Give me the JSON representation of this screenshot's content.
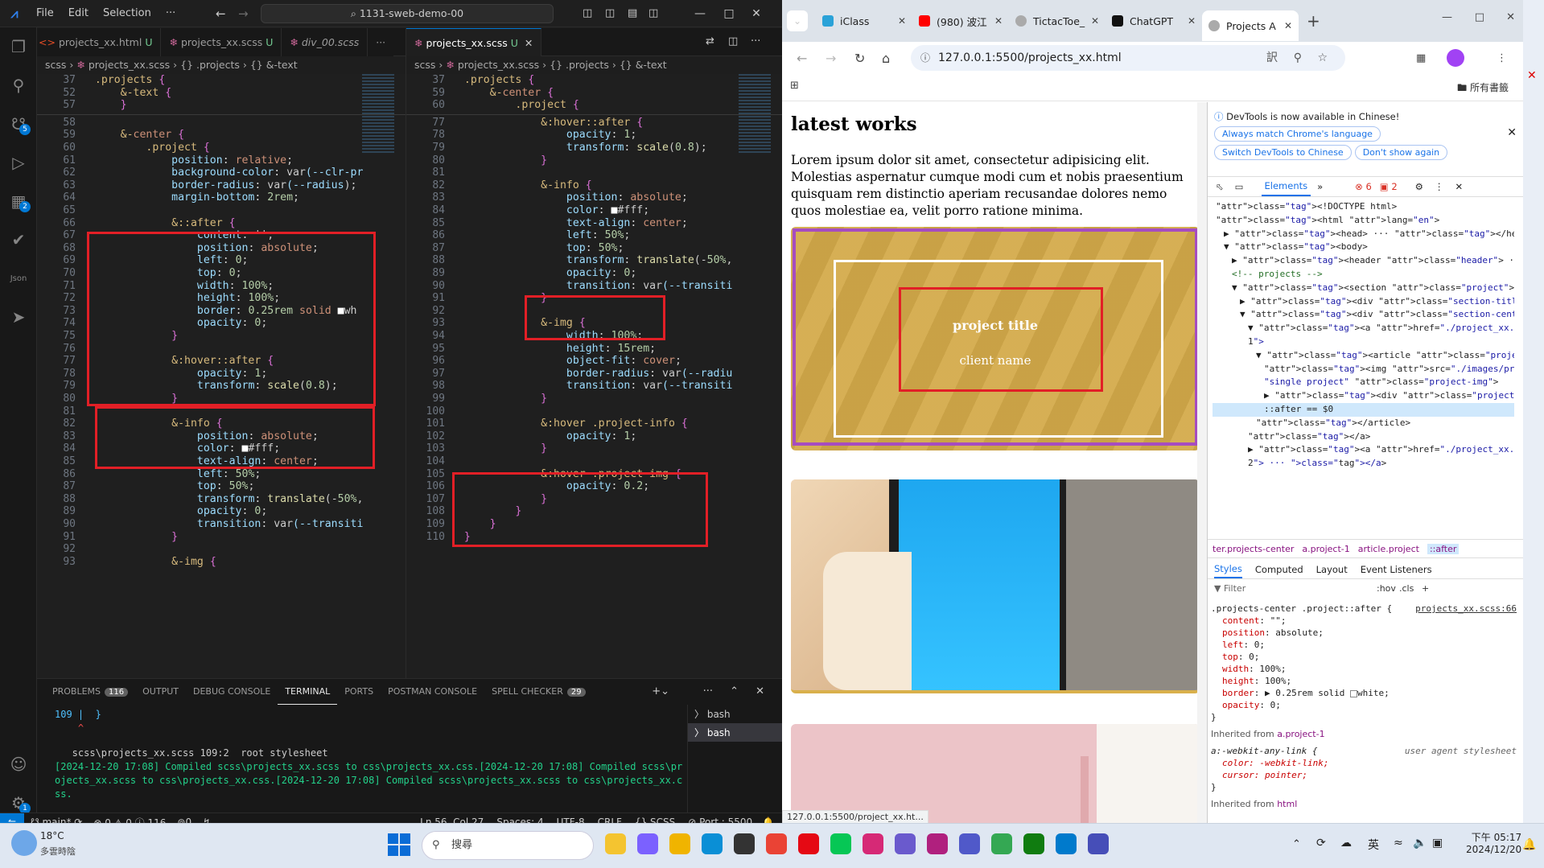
{
  "vscode": {
    "menu": [
      "File",
      "Edit",
      "Selection",
      "···"
    ],
    "command_center": "⌕ 1131-sweb-demo-00",
    "activity_badges": {
      "source_control": "5",
      "extensions": "2",
      "accounts_settings": "1"
    },
    "left_tabs": [
      {
        "label": "projects_xx.html",
        "status": "U"
      },
      {
        "label": "projects_xx.scss",
        "status": "U"
      },
      {
        "label": "div_00.scss",
        "status": ""
      }
    ],
    "right_tabs": [
      {
        "label": "projects_xx.scss",
        "status": "U"
      }
    ],
    "breadcrumb_left": [
      "scss",
      "projects_xx.scss",
      "{} .projects",
      "{} &-text"
    ],
    "breadcrumb_right": [
      "scss",
      "projects_xx.scss",
      "{} .projects",
      "{} &-text"
    ],
    "left_editor": {
      "sticky": [
        {
          "n": "37",
          "t": "  .projects {"
        },
        {
          "n": "52",
          "t": "      &-text {"
        },
        {
          "n": "57",
          "t": "      }"
        }
      ],
      "lines": [
        {
          "n": "58",
          "t": ""
        },
        {
          "n": "59",
          "t": "      &-center {"
        },
        {
          "n": "60",
          "t": "          .project {"
        },
        {
          "n": "61",
          "t": "              position: relative;"
        },
        {
          "n": "62",
          "t": "              background-color: var(--clr-pr"
        },
        {
          "n": "63",
          "t": "              border-radius: var(--radius);"
        },
        {
          "n": "64",
          "t": "              margin-bottom: 2rem;"
        },
        {
          "n": "65",
          "t": ""
        },
        {
          "n": "66",
          "t": "              &::after {"
        },
        {
          "n": "67",
          "t": "                  content: '';"
        },
        {
          "n": "68",
          "t": "                  position: absolute;"
        },
        {
          "n": "69",
          "t": "                  left: 0;"
        },
        {
          "n": "70",
          "t": "                  top: 0;"
        },
        {
          "n": "71",
          "t": "                  width: 100%;"
        },
        {
          "n": "72",
          "t": "                  height: 100%;"
        },
        {
          "n": "73",
          "t": "                  border: 0.25rem solid □wh"
        },
        {
          "n": "74",
          "t": "                  opacity: 0;"
        },
        {
          "n": "75",
          "t": "              }"
        },
        {
          "n": "76",
          "t": ""
        },
        {
          "n": "77",
          "t": "              &:hover::after {"
        },
        {
          "n": "78",
          "t": "                  opacity: 1;"
        },
        {
          "n": "79",
          "t": "                  transform: scale(0.8);"
        },
        {
          "n": "80",
          "t": "              }"
        },
        {
          "n": "81",
          "t": ""
        },
        {
          "n": "82",
          "t": "              &-info {"
        },
        {
          "n": "83",
          "t": "                  position: absolute;"
        },
        {
          "n": "84",
          "t": "                  color: □#fff;"
        },
        {
          "n": "85",
          "t": "                  text-align: center;"
        },
        {
          "n": "86",
          "t": "                  left: 50%;"
        },
        {
          "n": "87",
          "t": "                  top: 50%;"
        },
        {
          "n": "88",
          "t": "                  transform: translate(-50%,"
        },
        {
          "n": "89",
          "t": "                  opacity: 0;"
        },
        {
          "n": "90",
          "t": "                  transition: var(--transiti"
        },
        {
          "n": "91",
          "t": "              }"
        },
        {
          "n": "92",
          "t": ""
        },
        {
          "n": "93",
          "t": "              &-img {"
        }
      ]
    },
    "right_editor": {
      "sticky": [
        {
          "n": "37",
          "t": "  .projects {"
        },
        {
          "n": "59",
          "t": "      &-center {"
        },
        {
          "n": "60",
          "t": "          .project {"
        }
      ],
      "lines": [
        {
          "n": "77",
          "t": "              &:hover::after {"
        },
        {
          "n": "78",
          "t": "                  opacity: 1;"
        },
        {
          "n": "79",
          "t": "                  transform: scale(0.8);"
        },
        {
          "n": "80",
          "t": "              }"
        },
        {
          "n": "81",
          "t": ""
        },
        {
          "n": "82",
          "t": "              &-info {"
        },
        {
          "n": "83",
          "t": "                  position: absolute;"
        },
        {
          "n": "84",
          "t": "                  color: □#fff;"
        },
        {
          "n": "85",
          "t": "                  text-align: center;"
        },
        {
          "n": "86",
          "t": "                  left: 50%;"
        },
        {
          "n": "87",
          "t": "                  top: 50%;"
        },
        {
          "n": "88",
          "t": "                  transform: translate(-50%,"
        },
        {
          "n": "89",
          "t": "                  opacity: 0;"
        },
        {
          "n": "90",
          "t": "                  transition: var(--transiti"
        },
        {
          "n": "91",
          "t": "              }"
        },
        {
          "n": "92",
          "t": ""
        },
        {
          "n": "93",
          "t": "              &-img {"
        },
        {
          "n": "94",
          "t": "                  width: 100%;"
        },
        {
          "n": "95",
          "t": "                  height: 15rem;"
        },
        {
          "n": "96",
          "t": "                  object-fit: cover;"
        },
        {
          "n": "97",
          "t": "                  border-radius: var(--radiu"
        },
        {
          "n": "98",
          "t": "                  transition: var(--transiti"
        },
        {
          "n": "99",
          "t": "              }"
        },
        {
          "n": "100",
          "t": ""
        },
        {
          "n": "101",
          "t": "              &:hover .project-info {"
        },
        {
          "n": "102",
          "t": "                  opacity: 1;"
        },
        {
          "n": "103",
          "t": "              }"
        },
        {
          "n": "104",
          "t": ""
        },
        {
          "n": "105",
          "t": "              &:hover .project-img {"
        },
        {
          "n": "106",
          "t": "                  opacity: 0.2;"
        },
        {
          "n": "107",
          "t": "              }"
        },
        {
          "n": "108",
          "t": "          }"
        },
        {
          "n": "109",
          "t": "      }"
        },
        {
          "n": "110",
          "t": "  }"
        }
      ]
    },
    "panel": {
      "tabs": [
        {
          "label": "PROBLEMS",
          "badge": "116"
        },
        {
          "label": "OUTPUT",
          "badge": ""
        },
        {
          "label": "DEBUG CONSOLE",
          "badge": ""
        },
        {
          "label": "TERMINAL",
          "badge": ""
        },
        {
          "label": "PORTS",
          "badge": ""
        },
        {
          "label": "POSTMAN CONSOLE",
          "badge": ""
        },
        {
          "label": "SPELL CHECKER",
          "badge": "29"
        }
      ],
      "active_tab": "TERMINAL",
      "terminals": [
        "bash",
        "bash"
      ],
      "terminal_lines": [
        {
          "t": "109 |  }",
          "c": "#4fc1ff"
        },
        {
          "t": "    ^",
          "c": "#f14c4c"
        },
        {
          "t": "",
          "c": "#ccc"
        },
        {
          "t": "   scss\\projects_xx.scss 109:2  root stylesheet",
          "c": "#cccccc"
        },
        {
          "t": "[2024-12-20 17:08] Compiled scss\\projects_xx.scss to css\\projects_xx.css.[2024-12-20 17:08] Compiled scss\\pr",
          "c": "#23d18b"
        },
        {
          "t": "ojects_xx.scss to css\\projects_xx.css.[2024-12-20 17:08] Compiled scss\\projects_xx.scss to css\\projects_xx.c",
          "c": "#23d18b"
        },
        {
          "t": "ss.",
          "c": "#23d18b"
        }
      ]
    },
    "status": {
      "branch": "main*",
      "problems": "⊗ 0 ⚠ 0 ⓘ 116",
      "ports": "⊚0",
      "position": "Ln 56, Col 27",
      "spaces": "Spaces: 4",
      "encoding": "UTF-8",
      "eol": "CRLF",
      "language": "{} SCSS",
      "port": "⊘ Port : 5500"
    }
  },
  "chrome": {
    "tabs": [
      {
        "label": "iClass",
        "color": "#2aa2d8"
      },
      {
        "label": "(980) 波江",
        "color": "#ff0000"
      },
      {
        "label": "TictacToe_",
        "color": "#888"
      },
      {
        "label": "ChatGPT",
        "color": "#111"
      },
      {
        "label": "Projects A",
        "color": "#888"
      }
    ],
    "url": "127.0.0.1:5500/projects_xx.html",
    "bookmarks_label": "所有書籤",
    "status_url": "127.0.0.1:5500/project_xx.ht...",
    "page": {
      "heading": "latest works",
      "paragraph": "Lorem ipsum dolor sit amet, consectetur adipisicing elit. Molestias aspernatur cumque modi cum et nobis praesentium quisquam rem distinctio aperiam recusandae dolores nemo quos molestiae ea, velit porro ratione minima.",
      "project_title": "project title",
      "client_name": "client name"
    },
    "devtools": {
      "banner": "DevTools is now available in Chinese!",
      "banner_buttons": [
        "Always match Chrome's language",
        "Switch DevTools to Chinese",
        "Don't show again"
      ],
      "tabs": [
        "Elements"
      ],
      "errors": "6",
      "warnings": "2",
      "dom_lines": [
        {
          "i": 0,
          "h": "<!DOCTYPE html>"
        },
        {
          "i": 0,
          "h": "<html lang=\"en\">"
        },
        {
          "i": 1,
          "h": "▶ <head> ··· </head>"
        },
        {
          "i": 1,
          "h": "▼ <body>"
        },
        {
          "i": 2,
          "h": "▶ <header class=\"header\"> ··· </header>"
        },
        {
          "i": 2,
          "h": "<!-- projects -->"
        },
        {
          "i": 2,
          "h": "▼ <section class=\"project\">"
        },
        {
          "i": 3,
          "h": "▶ <div class=\"section-title\"> ··· </div>"
        },
        {
          "i": 3,
          "h": "▼ <div class=\"section-center projects-center\">"
        },
        {
          "i": 4,
          "h": "▼ <a href=\"./project_xx.html\" class=\"project-"
        },
        {
          "i": 4,
          "h": "1\">"
        },
        {
          "i": 5,
          "h": "▼ <article class=\"project\">"
        },
        {
          "i": 6,
          "h": "<img src=\"./images/project-1.jpeg\" alt="
        },
        {
          "i": 6,
          "h": "\"single project\" class=\"project-img\">"
        },
        {
          "i": 6,
          "h": "▶ <div class=\"project-info\"> ··· </div>"
        },
        {
          "i": 6,
          "h": "::after == $0"
        },
        {
          "i": 5,
          "h": "</article>"
        },
        {
          "i": 4,
          "h": "</a>"
        },
        {
          "i": 4,
          "h": "▶ <a href=\"./project_xx.html\" class=\"project-"
        },
        {
          "i": 4,
          "h": "2\"> ··· </a>"
        },
        {
          "i": 4,
          "h": "▶ <a href=\"./project_xx.html\" class=\"project-"
        },
        {
          "i": 4,
          "h": "3\"> ··· </a>"
        },
        {
          "i": 4,
          "h": "▶ <a href=\"./project_xx.html\" class=\"project-"
        },
        {
          "i": 4,
          "h": "4\"> ··· </a>"
        }
      ],
      "crumbs": [
        "ter.projects-center",
        "a.project-1",
        "article.project",
        "::after"
      ],
      "style_tabs": [
        "Styles",
        "Computed",
        "Layout",
        "Event Listeners"
      ],
      "filter_placeholder": "Filter",
      "filter_tools": [
        ":hov",
        ".cls"
      ],
      "rule_selector": ".projects-center .project::after {",
      "rule_source": "projects_xx.scss:66",
      "rule_props": [
        "content: \"\";",
        "position: absolute;",
        "left: 0;",
        "top: 0;",
        "width: 100%;",
        "height: 100%;",
        "border: ▶ 0.25rem solid □white;",
        "opacity: 0;"
      ],
      "inherited1": "Inherited from",
      "inherited1_el": "a.project-1",
      "ua_rule": "a:-webkit-any-link {",
      "ua_source": "user agent stylesheet",
      "ua_props": [
        "color: -webkit-link;",
        "cursor: pointer;"
      ],
      "inherited2": "Inherited from",
      "inherited2_el": "html"
    }
  },
  "taskbar": {
    "weather_temp": "18°C",
    "weather_text": "多雲時陰",
    "search": "搜尋",
    "ime": "英",
    "time": "下午 05:17",
    "date": "2024/12/20"
  },
  "colors": {
    "accent": "#0078d4",
    "highlight_box": "#e21f26",
    "project_card": "#d9b04b",
    "after_outline": "#a64cc0"
  }
}
